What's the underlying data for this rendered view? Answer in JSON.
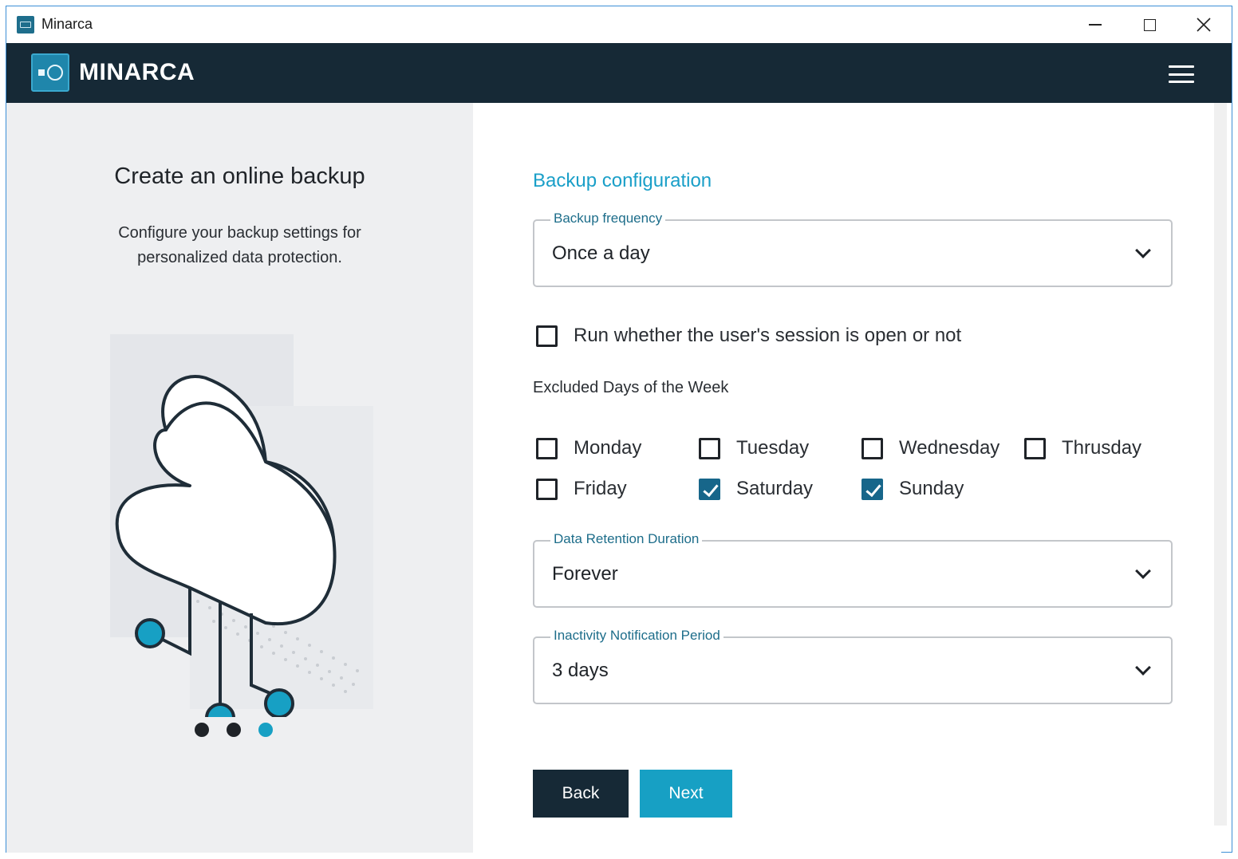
{
  "window": {
    "title": "Minarca"
  },
  "header": {
    "brand": "MINARCA"
  },
  "left_panel": {
    "heading": "Create an online backup",
    "description": "Configure your backup settings for personalized data protection.",
    "steps_total": 3,
    "step_current": 3
  },
  "form": {
    "section_title": "Backup configuration",
    "frequency": {
      "label": "Backup frequency",
      "value": "Once a day"
    },
    "run_session": {
      "label": "Run whether the user's session is open or not",
      "checked": false
    },
    "excluded_days_label": "Excluded Days of the Week",
    "days": [
      {
        "label": "Monday",
        "checked": false
      },
      {
        "label": "Tuesday",
        "checked": false
      },
      {
        "label": "Wednesday",
        "checked": false
      },
      {
        "label": "Thrusday",
        "checked": false
      },
      {
        "label": "Friday",
        "checked": false
      },
      {
        "label": "Saturday",
        "checked": true
      },
      {
        "label": "Sunday",
        "checked": true
      }
    ],
    "retention": {
      "label": "Data Retention Duration",
      "value": "Forever"
    },
    "inactivity": {
      "label": "Inactivity Notification Period",
      "value": "3 days"
    }
  },
  "buttons": {
    "back": "Back",
    "next": "Next"
  },
  "colors": {
    "header_bg": "#162936",
    "accent": "#17a0c4",
    "checkbox_checked": "#17668a"
  }
}
